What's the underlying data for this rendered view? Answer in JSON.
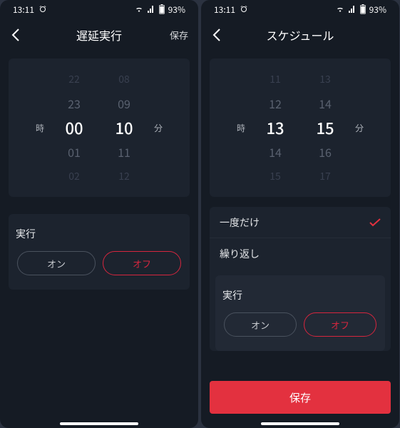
{
  "statusbar": {
    "time": "13:11",
    "battery": "93%"
  },
  "left": {
    "title": "遅延実行",
    "save": "保存",
    "hour_label": "時",
    "min_label": "分",
    "hours": {
      "pp": "22",
      "p": "23",
      "sel": "00",
      "n": "01",
      "nn": "02"
    },
    "mins": {
      "pp": "08",
      "p": "09",
      "sel": "10",
      "n": "11",
      "nn": "12"
    },
    "exec_label": "実行",
    "on": "オン",
    "off": "オフ"
  },
  "right": {
    "title": "スケジュール",
    "hour_label": "時",
    "min_label": "分",
    "hours": {
      "pp": "11",
      "p": "12",
      "sel": "13",
      "n": "14",
      "nn": "15"
    },
    "mins": {
      "pp": "13",
      "p": "14",
      "sel": "15",
      "n": "16",
      "nn": "17"
    },
    "once": "一度だけ",
    "repeat": "繰り返し",
    "exec_label": "実行",
    "on": "オン",
    "off": "オフ",
    "save": "保存"
  }
}
